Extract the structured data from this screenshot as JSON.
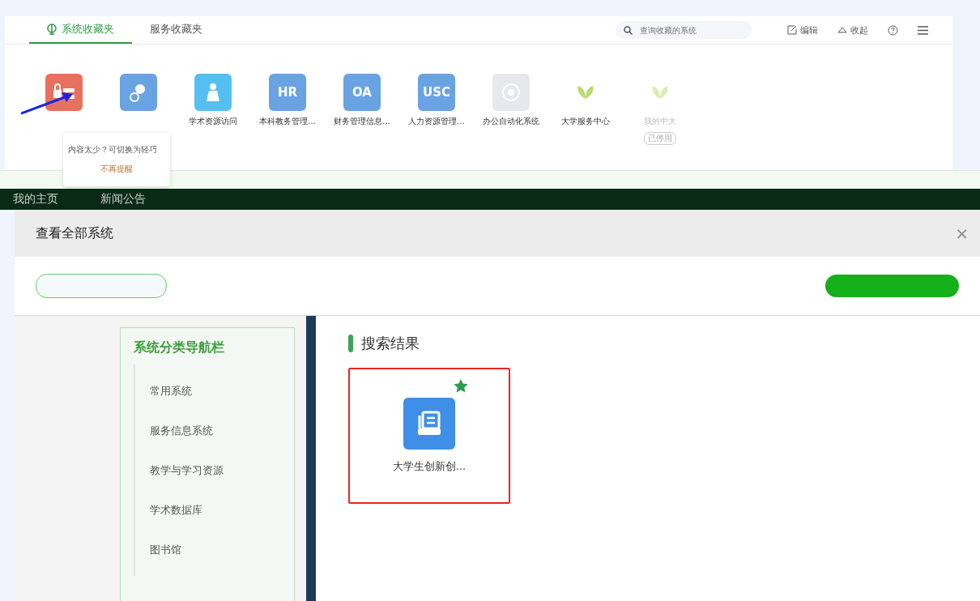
{
  "favorites": {
    "tabs": [
      {
        "label": "系统收藏夹",
        "selected": true
      },
      {
        "label": "服务收藏夹",
        "selected": false
      }
    ],
    "search": {
      "placeholder": "查询收藏的系统"
    },
    "actions": [
      {
        "kind": "edit",
        "label": "编辑"
      },
      {
        "kind": "collapse",
        "label": "收起"
      },
      {
        "kind": "help"
      },
      {
        "kind": "menu"
      }
    ],
    "items": [
      {
        "kind": "lock",
        "color": "#e8705e",
        "disabled": false
      },
      {
        "kind": "person",
        "color": "#6aa3e3",
        "disabled": false
      },
      {
        "kind": "bag",
        "color": "#55bff2",
        "label": "学术资源访问",
        "disabled": false
      },
      {
        "kind": "text",
        "icon_text": "HR",
        "color": "#6aa3e3",
        "label": "本科教务管理...",
        "disabled": false
      },
      {
        "kind": "text",
        "icon_text": "OA",
        "color": "#6aa3e3",
        "label": "财务管理信息...",
        "disabled": false
      },
      {
        "kind": "text",
        "icon_text": "USC",
        "color": "#6aa3e3",
        "label": "人力资源管理...",
        "disabled": false
      },
      {
        "kind": "badge",
        "color": "#e6e8ec",
        "label": "办公自动化系统",
        "disabled": false
      },
      {
        "kind": "leaf",
        "color": "#ffffff",
        "label": "大学服务中心",
        "disabled": false
      },
      {
        "kind": "leaf",
        "color": "#ffffff",
        "label": "我的中大",
        "disabled": true,
        "tag": "已停用"
      }
    ],
    "tip": {
      "text": "内容太少？可切换为轻巧",
      "link": "不再提醒"
    }
  },
  "nav": [
    "我的主页",
    "新闻公告"
  ],
  "dialog": {
    "title": "查看全部系统",
    "close": "×",
    "sidebar": {
      "title": "系统分类导航栏",
      "items": [
        {
          "label": "常用系统",
          "selected": false
        },
        {
          "label": "服务信息系统",
          "selected": false
        },
        {
          "label": "教学与学习资源",
          "selected": false
        },
        {
          "label": "学术数据库",
          "selected": false
        },
        {
          "label": "图书馆",
          "selected": false
        }
      ]
    },
    "results": {
      "title": "搜索结果",
      "items": [
        {
          "label": "大学生创新创...",
          "favorite": true,
          "highlighted": true
        }
      ]
    }
  }
}
